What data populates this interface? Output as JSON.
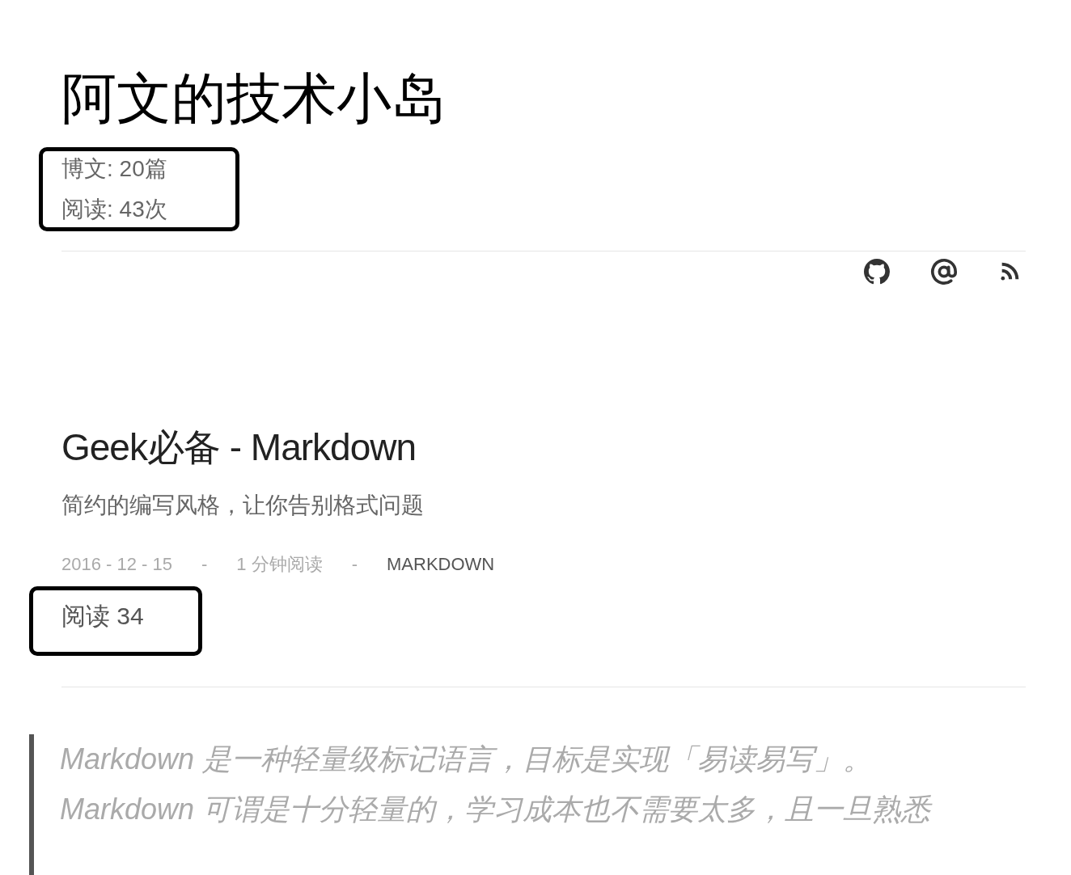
{
  "site": {
    "title": "阿文的技术小岛",
    "stats": [
      "博文: 20篇",
      "阅读: 43次"
    ]
  },
  "social_links": [
    {
      "kind": "github"
    },
    {
      "kind": "email"
    },
    {
      "kind": "rss"
    }
  ],
  "post": {
    "title": "Geek必备 - Markdown",
    "subtitle": "简约的编写风格，让你告别格式问题",
    "meta": {
      "date": "2016 - 12 - 15",
      "separator_1": "-",
      "read_time": "1 分钟阅读",
      "separator_2": "-",
      "tag": "MARKDOWN"
    },
    "views": "阅读 34",
    "quote_lines": [
      "Markdown 是一种轻量级标记语言，目标是实现「易读易写」。",
      "Markdown 可谓是十分轻量的，学习成本也不需要太多，且一旦熟悉"
    ]
  }
}
